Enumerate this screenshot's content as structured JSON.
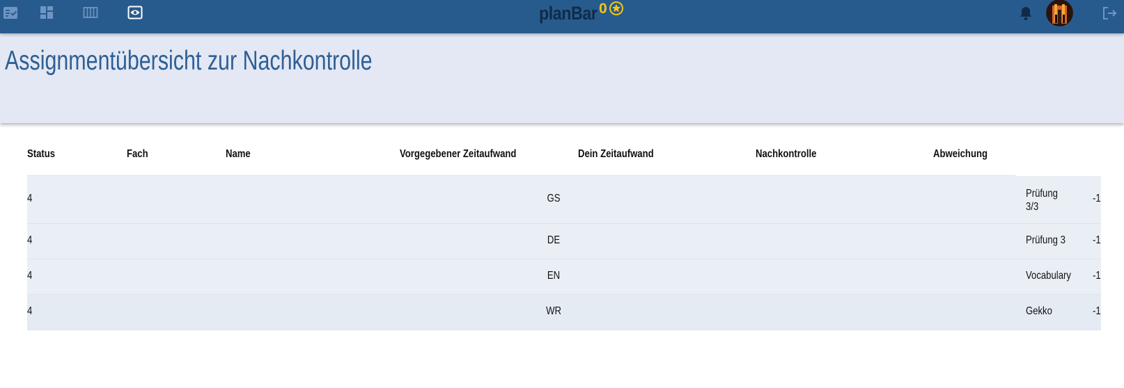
{
  "app": {
    "brand": "planBar",
    "points": "0",
    "accent": "#285b8d",
    "star_color": "#f5c518"
  },
  "nav": {
    "icons": [
      "tasks-check-icon",
      "dashboard-icon",
      "board-columns-icon",
      "preview-eye-icon"
    ],
    "active": "preview-eye-icon"
  },
  "page": {
    "title": "Assignmentübersicht zur Nachkontrolle"
  },
  "table": {
    "headers": [
      "Status",
      "Fach",
      "Name",
      "Vorgegebener Zeitaufwand",
      "Dein Zeitaufwand",
      "Nachkontrolle",
      "Abweichung"
    ],
    "rows": [
      {
        "status": "4",
        "fach": "GS",
        "name": "Prüfung 3/3",
        "abweichung": "-1"
      },
      {
        "status": "4",
        "fach": "DE",
        "name": "Prüfung 3",
        "abweichung": "-1"
      },
      {
        "status": "4",
        "fach": "EN",
        "name": "Vocabulary",
        "abweichung": "-1"
      },
      {
        "status": "4",
        "fach": "WR",
        "name": "Gekko",
        "abweichung": "-1"
      }
    ]
  }
}
